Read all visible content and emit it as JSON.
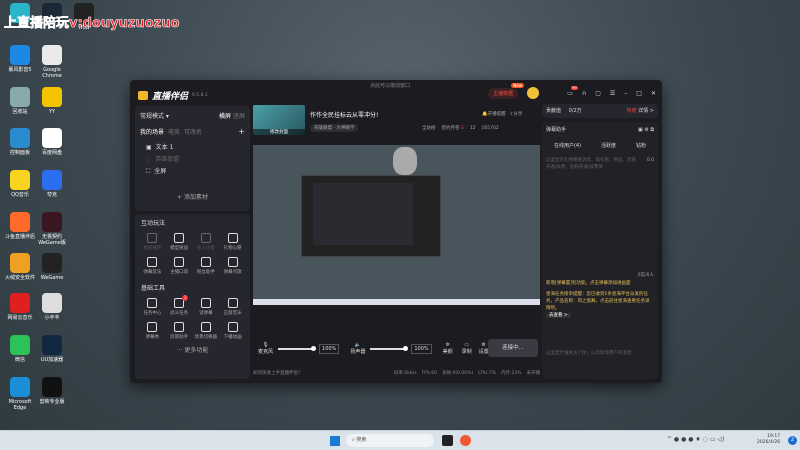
{
  "watermark": "上直播陪玩v:douyuzuozuo",
  "desktop": {
    "icons": [
      {
        "label": "",
        "color": "#2bb5c8"
      },
      {
        "label": "",
        "color": "#1b2838"
      },
      {
        "label": "HUB",
        "color": "#222"
      },
      {
        "label": "暴风影音5",
        "color": "#1e88e5"
      },
      {
        "label": "Google Chrome",
        "color": "#eaeaea"
      },
      {
        "label": "回收站",
        "color": "#8aa"
      },
      {
        "label": "YY",
        "color": "#f5c400"
      },
      {
        "label": "控制面板",
        "color": "#2a8ccf"
      },
      {
        "label": "百度网盘",
        "color": "#fff"
      },
      {
        "label": "QQ音乐",
        "color": "#f8d320"
      },
      {
        "label": "夸克",
        "color": "#2b6ff0"
      },
      {
        "label": "斗鱼直播伴侣",
        "color": "#ff6a2b"
      },
      {
        "label": "无畏契约 WeGame版",
        "color": "#3a1620"
      },
      {
        "label": "火绒安全软件",
        "color": "#f0a020"
      },
      {
        "label": "WeGame",
        "color": "#222"
      },
      {
        "label": "网易云音乐",
        "color": "#e02020"
      },
      {
        "label": "小丰丰",
        "color": "#ddd"
      },
      {
        "label": "微信",
        "color": "#2dc15a"
      },
      {
        "label": "UU加速器",
        "color": "#102840"
      },
      {
        "label": "Microsoft Edge",
        "color": "#1a8fd8"
      },
      {
        "label": "剪映专业版",
        "color": "#111"
      }
    ]
  },
  "window": {
    "drag_hint": "点此可以拖动窗口",
    "app_name": "直播伴侣",
    "version": "6.5.8.1",
    "anchor_data_label": "主播数据",
    "new_badge": "New",
    "msg_count": "99",
    "mode_label": "常规模式",
    "landscape": "横屏",
    "portrait": "竖屏",
    "scenes_tabs": [
      "我的场景",
      "电竞",
      "可改名"
    ],
    "scenes": [
      {
        "name": "文本 1"
      },
      {
        "name": "英雄联盟"
      },
      {
        "name": "全屏"
      }
    ],
    "add_material": "添加素材",
    "cover_label": "修改封面",
    "stream_title": "作作全民挂标云从零冲分!",
    "category": "英雄联盟 - 大神教学",
    "open_remind": "开播提醒",
    "share": "分享",
    "all_station": "全站榜",
    "signed_fans": "签约月卷",
    "signed_count": "2",
    "likes": "12",
    "hearts": "165702",
    "interact_title": "互动玩法",
    "interact": [
      "福利抽奖",
      "模型挑战",
      "多人连麦",
      "礼物心愿",
      "弹幕玩法",
      "主播口袋",
      "粉丝助手",
      "弹幕点歌"
    ],
    "tools_title": "基础工具",
    "tools": [
      "任务中心",
      "武斗任务",
      "读弹幕",
      "正版音乐",
      "弹幕秀",
      "房管助手",
      "场景切换器",
      "下播动画"
    ],
    "tools_badge": "1",
    "more": "更多功能",
    "mic_label": "麦克风",
    "mic_volume": "100%",
    "speaker_label": "扬声器",
    "speaker_volume": "100%",
    "beauty": "美颜",
    "record": "录制",
    "settings": "设置",
    "connect": "连接中...",
    "help": "如何快速上手直播伴侣?",
    "status": [
      "码率:0kb/s",
      "FPS:60",
      "丢帧:0(0.00%)",
      "CPU:7%",
      "内存:23%",
      "未开播"
    ],
    "contribution": "贡献值",
    "contribution_value": "0/2万",
    "hot": "热度",
    "detail": "详情 >",
    "danmu_title": "弹幕助手",
    "danmu_tabs": [
      "在线用户(4)",
      "活跃度",
      "钻粉"
    ],
    "gift_count": "0.0",
    "gift_placeholder": "这里显示礼物相关消息，如礼物、粉丝、贵族开通/续费、钻粉开通/续费等",
    "online_count": "0实/0人",
    "notice1": "新增[弹幕置顶]功能，点击弹幕添加进画面",
    "notice2": "星海任务接单提醒：您已收到1条星海平台派发的任务，产品名称：风之旅舞，点击前往星海查看任务详情吧。",
    "go_view": "去查看 >",
    "follow_placeholder": "这里显示谁关注了你，以及新场用户的消息"
  },
  "taskbar": {
    "search": "搜索",
    "time": "19:17",
    "date": "2026/4/26",
    "notif": "2"
  }
}
